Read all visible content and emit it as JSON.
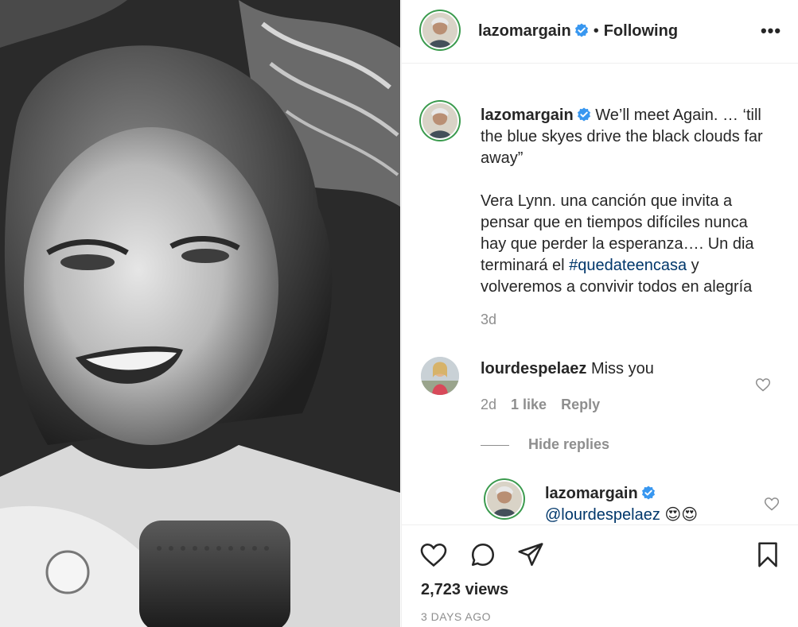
{
  "post": {
    "author": "lazomargain",
    "follow_status": "Following",
    "more_label": "•••",
    "caption_line1": "We’ll meet Again. …",
    "caption_line2": "‘till the blue skyes drive the black clouds far away”",
    "caption_para2_before": "Vera Lynn. una canción que invita a pensar que en tiempos difíciles nunca hay que perder la esperanza…. Un dia terminará el ",
    "caption_hashtag": "#quedateencasa",
    "caption_para2_after": " y volveremos a convivir todos en alegría",
    "time_ago": "3d"
  },
  "comment": {
    "author": "lourdespelaez",
    "text": "Miss you",
    "time_ago": "2d",
    "likes": "1 like",
    "reply_label": "Reply"
  },
  "hide_replies_label": "Hide replies",
  "reply": {
    "author": "lazomargain",
    "mention": "@lourdespelaez",
    "emoji": "😍😍"
  },
  "footer": {
    "views": "2,723 views",
    "date": "3 DAYS AGO"
  },
  "icons": {
    "verified": "verified-badge-icon",
    "like": "heart-icon",
    "comment": "comment-bubble-icon",
    "share": "paper-plane-icon",
    "save": "bookmark-icon"
  },
  "colors": {
    "verified_blue": "#3897f0",
    "hashtag_blue": "#00376b",
    "muted_text": "#8e8e8e",
    "story_ring": "#3a9a4d"
  }
}
